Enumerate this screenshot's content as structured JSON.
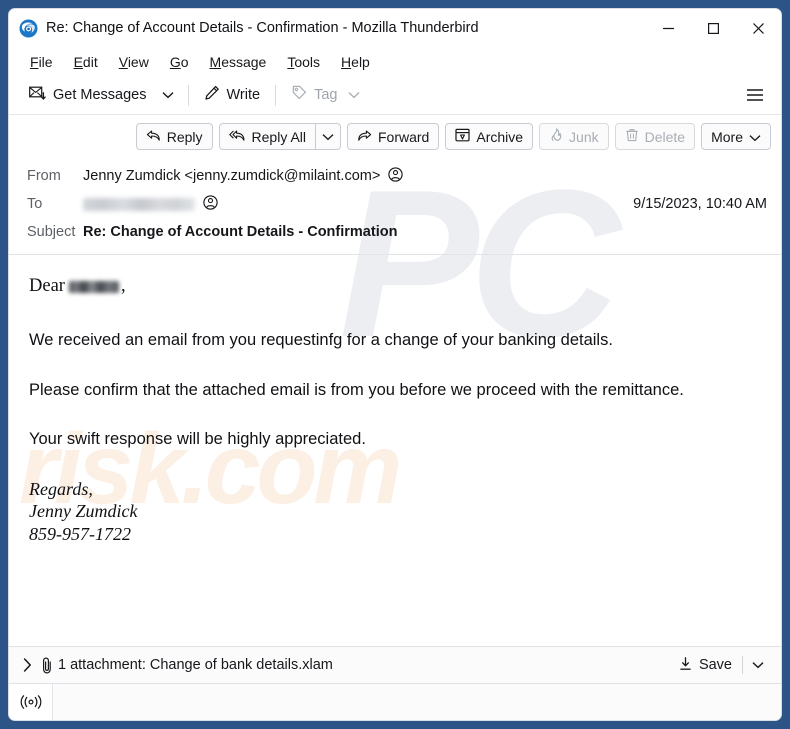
{
  "window": {
    "title": "Re: Change of Account Details - Confirmation - Mozilla Thunderbird",
    "app_icon": "thunderbird-icon",
    "controls": {
      "minimize": "minimize-icon",
      "maximize": "maximize-icon",
      "close": "close-icon"
    },
    "border_color": "#2c5486"
  },
  "menubar": {
    "items": [
      {
        "label": "File",
        "accesskey": "F"
      },
      {
        "label": "Edit",
        "accesskey": "E"
      },
      {
        "label": "View",
        "accesskey": "V"
      },
      {
        "label": "Go",
        "accesskey": "G"
      },
      {
        "label": "Message",
        "accesskey": "M"
      },
      {
        "label": "Tools",
        "accesskey": "T"
      },
      {
        "label": "Help",
        "accesskey": "H"
      }
    ]
  },
  "toolbar": {
    "get_messages": "Get Messages",
    "write": "Write",
    "tag": "Tag",
    "tag_disabled": true,
    "hamburger": "app-menu-icon"
  },
  "message_actions": [
    {
      "label": "Reply",
      "icon": "reply-icon",
      "disabled": false
    },
    {
      "label": "Reply All",
      "icon": "reply-all-icon",
      "disabled": false
    },
    {
      "label": "Forward",
      "icon": "forward-icon",
      "disabled": false
    },
    {
      "label": "Archive",
      "icon": "archive-icon",
      "disabled": false
    },
    {
      "label": "Junk",
      "icon": "junk-icon",
      "disabled": true
    },
    {
      "label": "Delete",
      "icon": "trash-icon",
      "disabled": true
    },
    {
      "label": "More",
      "icon": "chevron-down-icon",
      "disabled": false
    }
  ],
  "headers": {
    "from_label": "From",
    "from_value": "Jenny Zumdick <jenny.zumdick@milaint.com>",
    "to_label": "To",
    "to_value": "",
    "to_redacted": true,
    "subject_label": "Subject",
    "subject_value": "Re: Change of Account Details - Confirmation",
    "date": "9/15/2023, 10:40 AM"
  },
  "body": {
    "greeting_prefix": "Dear",
    "greeting_suffix": ",",
    "greeting_redacted": true,
    "paragraph1": "We received an email from you requestinfg for a change of your banking details.",
    "paragraph2": "Please confirm that the attached email is from you before we proceed with the remittance.",
    "paragraph3": "Your swift response will be highly appreciated.",
    "signature_line1": "Regards,",
    "signature_line2": "Jenny Zumdick",
    "signature_line3": "859-957-1722"
  },
  "attachment": {
    "expander": "chevron-right-icon",
    "paperclip": "paperclip-icon",
    "text": "1 attachment: Change of bank details.xlam",
    "save_label": "Save",
    "save_icon": "download-icon",
    "save_caret": "chevron-down-icon"
  },
  "statusbar": {
    "icon": "connection-icon",
    "text": ""
  },
  "watermarks": {
    "logo": "PC",
    "site": "risk.com"
  }
}
